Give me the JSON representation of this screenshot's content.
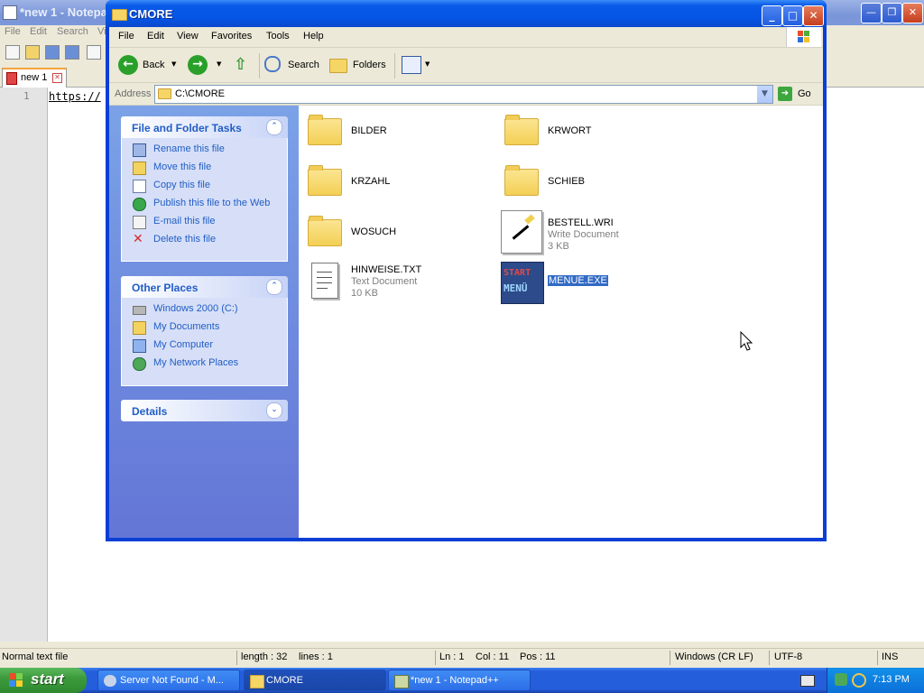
{
  "notepad": {
    "title": "*new 1 - Notepa",
    "menu": [
      "File",
      "Edit",
      "Search",
      "Vi"
    ],
    "tab_label": "new 1",
    "line_number": "1",
    "code_text": "https://",
    "status": {
      "type": "Normal text file",
      "length": "length : 32",
      "lines": "lines : 1",
      "ln": "Ln : 1",
      "col": "Col : 11",
      "pos": "Pos : 11",
      "eol": "Windows (CR LF)",
      "encoding": "UTF-8",
      "mode": "INS"
    }
  },
  "explorer": {
    "title": "CMORE",
    "menu": [
      "File",
      "Edit",
      "View",
      "Favorites",
      "Tools",
      "Help"
    ],
    "toolbar": {
      "back": "Back",
      "search": "Search",
      "folders": "Folders"
    },
    "address": {
      "label": "Address",
      "value": "C:\\CMORE",
      "go": "Go"
    },
    "task_pane": {
      "file_tasks": {
        "title": "File and Folder Tasks",
        "items": [
          {
            "label": "Rename this file",
            "icon": "rename-icon"
          },
          {
            "label": "Move this file",
            "icon": "move-icon"
          },
          {
            "label": "Copy this file",
            "icon": "copy-icon"
          },
          {
            "label": "Publish this file to the Web",
            "icon": "publish-web-icon"
          },
          {
            "label": "E-mail this file",
            "icon": "email-icon"
          },
          {
            "label": "Delete this file",
            "icon": "delete-icon"
          }
        ]
      },
      "other_places": {
        "title": "Other Places",
        "items": [
          {
            "label": "Windows 2000 (C:)",
            "icon": "drive-icon"
          },
          {
            "label": "My Documents",
            "icon": "my-documents-icon"
          },
          {
            "label": "My Computer",
            "icon": "my-computer-icon"
          },
          {
            "label": "My Network Places",
            "icon": "network-places-icon"
          }
        ]
      },
      "details": {
        "title": "Details"
      }
    },
    "files": [
      {
        "name": "BILDER",
        "type": "folder"
      },
      {
        "name": "KRWORT",
        "type": "folder"
      },
      {
        "name": "KRZAHL",
        "type": "folder"
      },
      {
        "name": "SCHIEB",
        "type": "folder"
      },
      {
        "name": "WOSUCH",
        "type": "folder"
      },
      {
        "name": "BESTELL.WRI",
        "type": "file",
        "desc": "Write Document",
        "size": "3 KB"
      },
      {
        "name": "HINWEISE.TXT",
        "type": "file",
        "desc": "Text Document",
        "size": "10 KB"
      },
      {
        "name": "MENUE.EXE",
        "type": "exe",
        "selected": true,
        "icon_text": [
          "START",
          "MENÜ"
        ]
      }
    ]
  },
  "taskbar": {
    "start": "start",
    "tasks": [
      {
        "label": "Server Not Found - M..."
      },
      {
        "label": "CMORE"
      },
      {
        "label": "*new 1 - Notepad++"
      }
    ],
    "clock": "7:13 PM"
  },
  "colors": {
    "xp_blue": "#0a5ae8",
    "task_pane_link": "#215dc6",
    "selection": "#316ac5",
    "start_green": "#3c9a3c"
  }
}
